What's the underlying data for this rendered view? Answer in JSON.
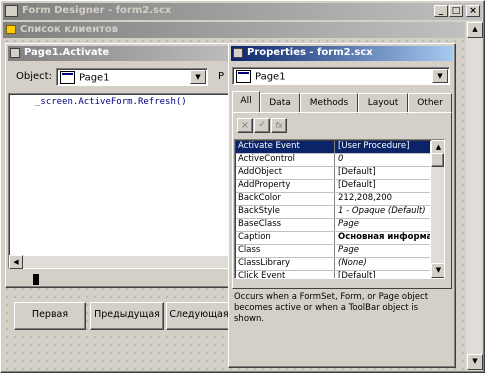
{
  "main_window": {
    "title": "Form Designer - form2.scx"
  },
  "form_window": {
    "title": "Список клиентов"
  },
  "code_window": {
    "title": "Page1.Activate",
    "object_label": "Object:",
    "object_value": "Page1",
    "proc_label": "P",
    "code_line": "_screen.ActiveForm.Refresh()"
  },
  "form_buttons": [
    "Первая",
    "Предыдущая",
    "Следующая"
  ],
  "properties": {
    "title": "Properties - form2.scx",
    "object": "Page1",
    "tabs": [
      "All",
      "Data",
      "Methods",
      "Layout",
      "Other"
    ],
    "toolbar": {
      "cancel": "×",
      "accept": "✓",
      "fx": "fx"
    },
    "rows": [
      {
        "name": "Activate Event",
        "value": "[User Procedure]",
        "selected": true,
        "style": "normal"
      },
      {
        "name": "ActiveControl",
        "value": "0",
        "style": "italic"
      },
      {
        "name": "AddObject",
        "value": "[Default]",
        "style": "normal"
      },
      {
        "name": "AddProperty",
        "value": "[Default]",
        "style": "normal"
      },
      {
        "name": "BackColor",
        "value": "212,208,200",
        "style": "normal"
      },
      {
        "name": "BackStyle",
        "value": "1 - Opaque (Default)",
        "style": "italic"
      },
      {
        "name": "BaseClass",
        "value": "Page",
        "style": "italic"
      },
      {
        "name": "Caption",
        "value": "Основная информа",
        "style": "bold"
      },
      {
        "name": "Class",
        "value": "Page",
        "style": "italic"
      },
      {
        "name": "ClassLibrary",
        "value": "(None)",
        "style": "italic"
      },
      {
        "name": "Click Event",
        "value": "[Default]",
        "style": "normal"
      }
    ],
    "description": "Occurs when a FormSet, Form, or Page object becomes active or when a ToolBar object is shown."
  },
  "window_buttons": {
    "minimize": "_",
    "maximize": "□",
    "close": "×"
  },
  "colors": {
    "title_active": "#0a246a",
    "face": "#d4d0c8",
    "selection": "#0a246a"
  }
}
